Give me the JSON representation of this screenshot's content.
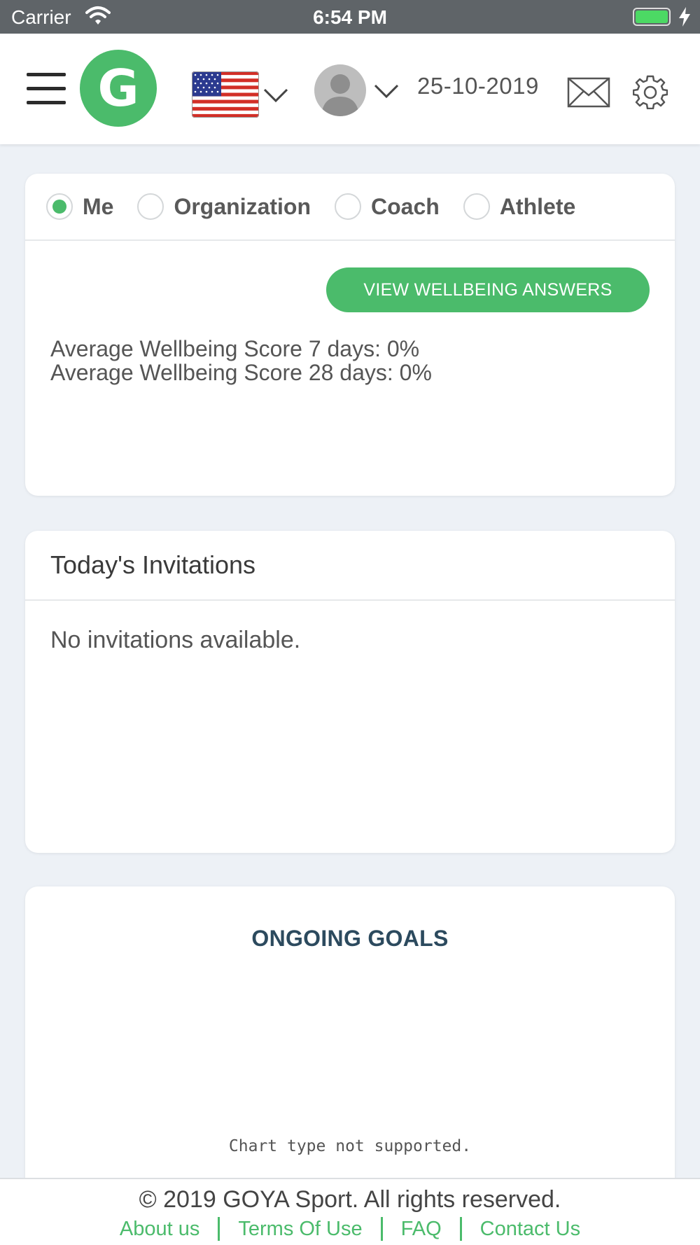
{
  "status_bar": {
    "carrier": "Carrier",
    "time": "6:54 PM"
  },
  "header": {
    "logo_letter": "G",
    "date": "25-10-2019",
    "icons": [
      "menu-icon",
      "us-flag-icon",
      "chevron-down-icon",
      "avatar",
      "mail-icon",
      "gear-icon"
    ]
  },
  "wellbeing": {
    "filters": [
      {
        "label": "Me",
        "selected": true
      },
      {
        "label": "Organization",
        "selected": false
      },
      {
        "label": "Coach",
        "selected": false
      },
      {
        "label": "Athlete",
        "selected": false
      }
    ],
    "button_label": "VIEW WELLBEING ANSWERS",
    "score_7": "Average Wellbeing Score 7 days: 0%",
    "score_28": "Average Wellbeing Score 28 days: 0%"
  },
  "invitations": {
    "title": "Today's Invitations",
    "empty_message": "No invitations available."
  },
  "goals": {
    "title": "ONGOING GOALS",
    "chart_message": "Chart type not supported."
  },
  "footer": {
    "copyright": "© 2019 GOYA Sport. All rights reserved.",
    "links": [
      "About us",
      "Terms Of Use",
      "FAQ",
      "Contact Us"
    ]
  },
  "colors": {
    "accent": "#4bbb6b",
    "heading_dark": "#2c4a5e",
    "background": "#edf1f6",
    "status_bar": "#5f6468"
  }
}
